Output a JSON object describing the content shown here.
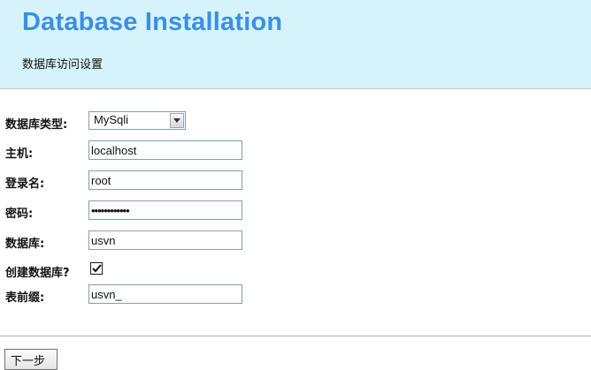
{
  "header": {
    "title": "Database Installation",
    "subtitle": "数据库访问设置"
  },
  "form": {
    "db_type": {
      "label": "数据库类型:",
      "value": "MySqli"
    },
    "host": {
      "label": "主机:",
      "value": "localhost"
    },
    "login": {
      "label": "登录名:",
      "value": "root"
    },
    "password": {
      "label": "密码:",
      "value": "••••••••••••"
    },
    "database": {
      "label": "数据库:",
      "value": "usvn"
    },
    "create_db": {
      "label": "创建数据库?",
      "checked": true
    },
    "prefix": {
      "label": "表前缀:",
      "value": "usvn_"
    }
  },
  "actions": {
    "next_label": "下一步"
  },
  "colors": {
    "header_bg": "#d6f2fb",
    "title": "#3a8fe5",
    "input_border": "#7f9db9"
  }
}
